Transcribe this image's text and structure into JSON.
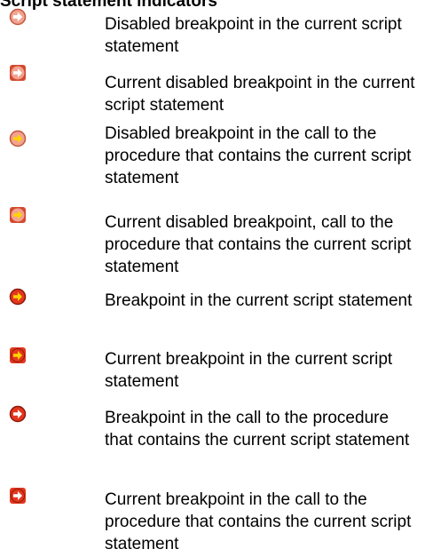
{
  "heading": "Script statement indicators",
  "indicators": [
    {
      "icon": "disabled-breakpoint-icon",
      "text": "Disabled breakpoint in the current script statement"
    },
    {
      "icon": "current-disabled-breakpoint-icon",
      "text": "Current disabled breakpoint in the current script statement"
    },
    {
      "icon": "disabled-breakpoint-call-icon",
      "text": "Disabled breakpoint in the call to the procedure that contains the current script statement"
    },
    {
      "icon": "current-disabled-breakpoint-call-icon",
      "text": "Current disabled breakpoint, call to the procedure that contains the current script statement"
    },
    {
      "icon": "breakpoint-icon",
      "text": "Breakpoint in the current script statement"
    },
    {
      "icon": "current-breakpoint-icon",
      "text": "Current breakpoint in the current script statement"
    },
    {
      "icon": "breakpoint-call-icon",
      "text": "Breakpoint in the call to the procedure that contains the current script statement"
    },
    {
      "icon": "current-breakpoint-call-icon",
      "text": "Current breakpoint in the call to the procedure that contains the current script statement"
    }
  ],
  "colors": {
    "disabled_fill": "#f2a391",
    "disabled_stroke": "#c4553c",
    "enabled_fill": "#e3361d",
    "enabled_stroke": "#8c1a0c",
    "current_arrow": "#ffd400",
    "plain_arrow": "#ffffff",
    "current_square": "#d24a30"
  }
}
